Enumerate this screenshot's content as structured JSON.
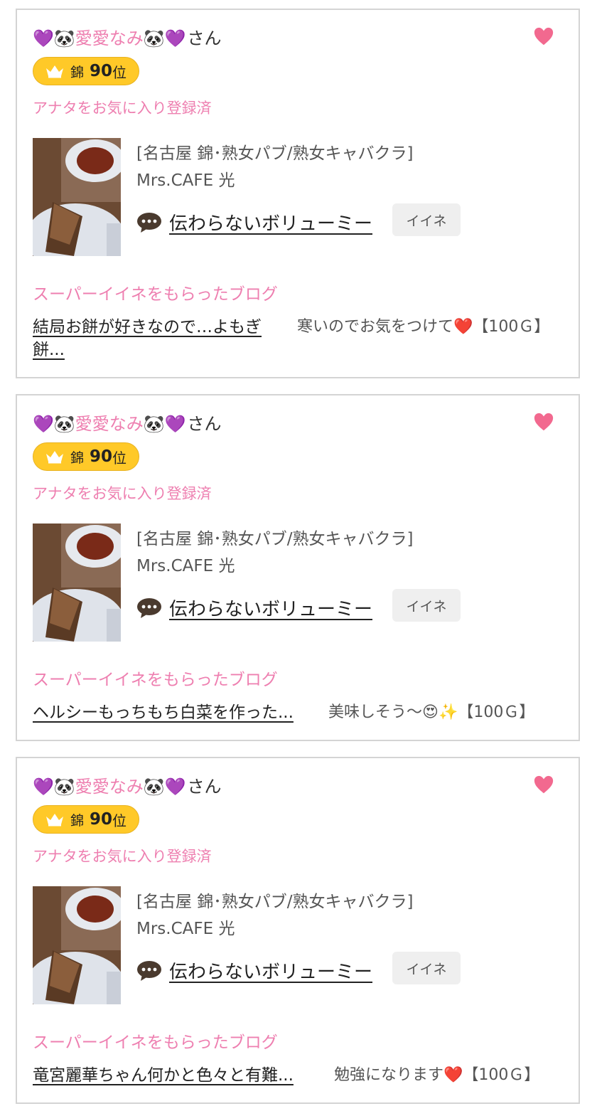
{
  "cards": [
    {
      "name_emoji_left": "💜🐼",
      "name": "愛愛なみ",
      "name_emoji_right": "🐼💜",
      "name_suffix": "さん",
      "rank_area": "錦",
      "rank_number": "90",
      "rank_unit": "位",
      "favorite_status": "アナタをお気に入り登録済",
      "shop_category": "[名古屋 錦･熟女パブ/熟女キャバクラ]",
      "shop_name": "Mrs.CAFE 光",
      "cast_name": "伝わらないボリューミー",
      "like_label": "イイネ",
      "super_like_label": "スーパーイイネをもらったブログ",
      "blog_title": "結局お餅が好きなので…よもぎ餅...",
      "comment_text": "寒いのでお気をつけて",
      "comment_emoji": "❤️",
      "comment_amount": "【100Ｇ】"
    },
    {
      "name_emoji_left": "💜🐼",
      "name": "愛愛なみ",
      "name_emoji_right": "🐼💜",
      "name_suffix": "さん",
      "rank_area": "錦",
      "rank_number": "90",
      "rank_unit": "位",
      "favorite_status": "アナタをお気に入り登録済",
      "shop_category": "[名古屋 錦･熟女パブ/熟女キャバクラ]",
      "shop_name": "Mrs.CAFE 光",
      "cast_name": "伝わらないボリューミー",
      "like_label": "イイネ",
      "super_like_label": "スーパーイイネをもらったブログ",
      "blog_title": "ヘルシーもっちもち白菜を作った...",
      "comment_text": "美味しそう～",
      "comment_emoji": "😍✨",
      "comment_amount": "【100Ｇ】"
    },
    {
      "name_emoji_left": "💜🐼",
      "name": "愛愛なみ",
      "name_emoji_right": "🐼💜",
      "name_suffix": "さん",
      "rank_area": "錦",
      "rank_number": "90",
      "rank_unit": "位",
      "favorite_status": "アナタをお気に入り登録済",
      "shop_category": "[名古屋 錦･熟女パブ/熟女キャバクラ]",
      "shop_name": "Mrs.CAFE 光",
      "cast_name": "伝わらないボリューミー",
      "like_label": "イイネ",
      "super_like_label": "スーパーイイネをもらったブログ",
      "blog_title": "竜宮麗華ちゃん何かと色々と有難...",
      "comment_text": "勉強になります",
      "comment_emoji": "❤️",
      "comment_amount": "【100Ｇ】"
    }
  ],
  "colors": {
    "pink": "#ee7fb0",
    "heart": "#f2698f",
    "badge": "#ffc928",
    "border": "#d4d4d4"
  },
  "icons": [
    "heart-icon",
    "crown-icon",
    "chat-bubble-icon"
  ]
}
